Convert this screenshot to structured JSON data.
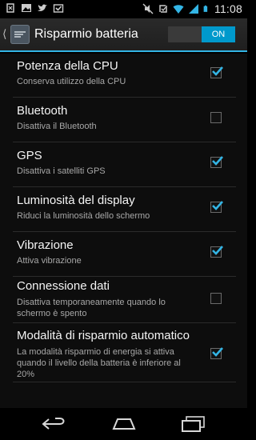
{
  "status_bar": {
    "time": "11:08",
    "left_icons": [
      "usb-debug-icon",
      "gallery-icon",
      "twitter-icon",
      "download-complete-icon"
    ],
    "right_icons": [
      "mute-icon",
      "sync-icon",
      "wifi-icon",
      "signal-icon",
      "battery-icon"
    ]
  },
  "action_bar": {
    "title": "Risparmio batteria",
    "toggle_label": "ON",
    "toggle_on": true,
    "accent": "#33b5e5"
  },
  "settings": [
    {
      "title": "Potenza della CPU",
      "summary": "Conserva utilizzo della CPU",
      "checked": true
    },
    {
      "title": "Bluetooth",
      "summary": "Disattiva il Bluetooth",
      "checked": false
    },
    {
      "title": "GPS",
      "summary": "Disattiva i satelliti GPS",
      "checked": true
    },
    {
      "title": "Luminosità del display",
      "summary": "Riduci la luminosità dello schermo",
      "checked": true
    },
    {
      "title": "Vibrazione",
      "summary": "Attiva vibrazione",
      "checked": true
    },
    {
      "title": "Connessione dati",
      "summary": "Disattiva temporaneamente quando lo schermo è spento",
      "checked": false
    },
    {
      "title": "Modalità di risparmio automatico",
      "summary": "La modalità risparmio di energia si attiva quando il livello della batteria è inferiore al 20%",
      "checked": true
    }
  ],
  "checkbox_color": "#33b5e5",
  "nav_bar": {
    "buttons": [
      "back-icon",
      "home-icon",
      "recent-apps-icon"
    ]
  }
}
